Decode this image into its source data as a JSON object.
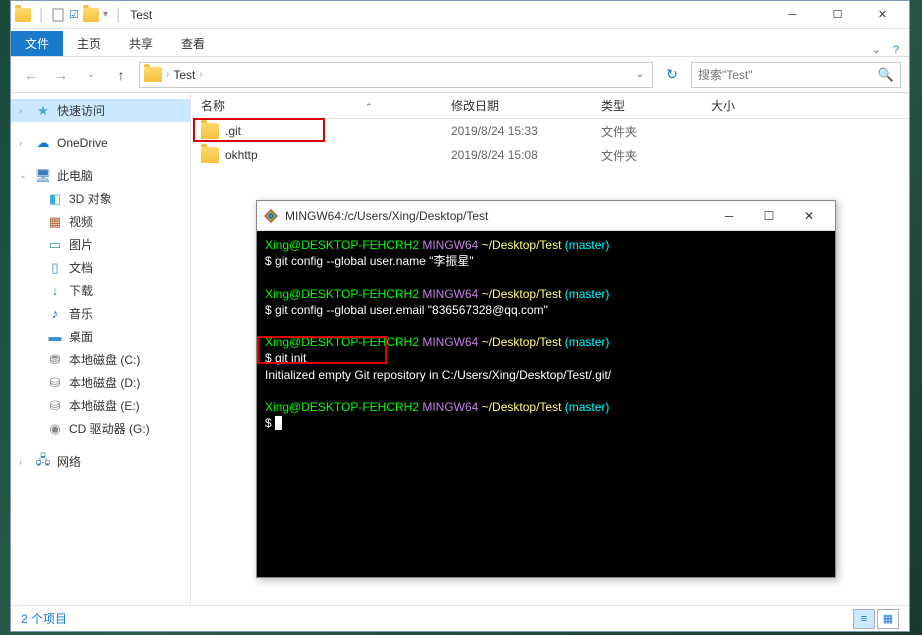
{
  "explorer": {
    "title": "Test",
    "ribbon": {
      "file": "文件",
      "home": "主页",
      "share": "共享",
      "view": "查看"
    },
    "nav": {
      "breadcrumb": "Test",
      "search_placeholder": "搜索\"Test\""
    },
    "sidebar": {
      "quickaccess": "快速访问",
      "onedrive": "OneDrive",
      "thispc": "此电脑",
      "objects3d": "3D 对象",
      "videos": "视频",
      "pictures": "图片",
      "documents": "文档",
      "downloads": "下载",
      "music": "音乐",
      "desktop": "桌面",
      "diskC": "本地磁盘 (C:)",
      "diskD": "本地磁盘 (D:)",
      "diskE": "本地磁盘 (E:)",
      "cdG": "CD 驱动器 (G:)",
      "network": "网络"
    },
    "columns": {
      "name": "名称",
      "date": "修改日期",
      "type": "类型",
      "size": "大小"
    },
    "files": [
      {
        "name": ".git",
        "date": "2019/8/24 15:33",
        "type": "文件夹"
      },
      {
        "name": "okhttp",
        "date": "2019/8/24 15:08",
        "type": "文件夹"
      }
    ],
    "status": "2 个项目"
  },
  "terminal": {
    "title": "MINGW64:/c/Users/Xing/Desktop/Test",
    "prompt_user": "Xing@DESKTOP-FEHCRH2",
    "prompt_env": "MINGW64",
    "prompt_path": "~/Desktop/Test",
    "prompt_branch": "(master)",
    "cmd1": "git config --global user.name \"李振星\"",
    "cmd2": "git config --global user.email \"836567328@qq.com\"",
    "cmd3": "git init",
    "out3": "Initialized empty Git repository in C:/Users/Xing/Desktop/Test/.git/",
    "dollar": "$"
  }
}
